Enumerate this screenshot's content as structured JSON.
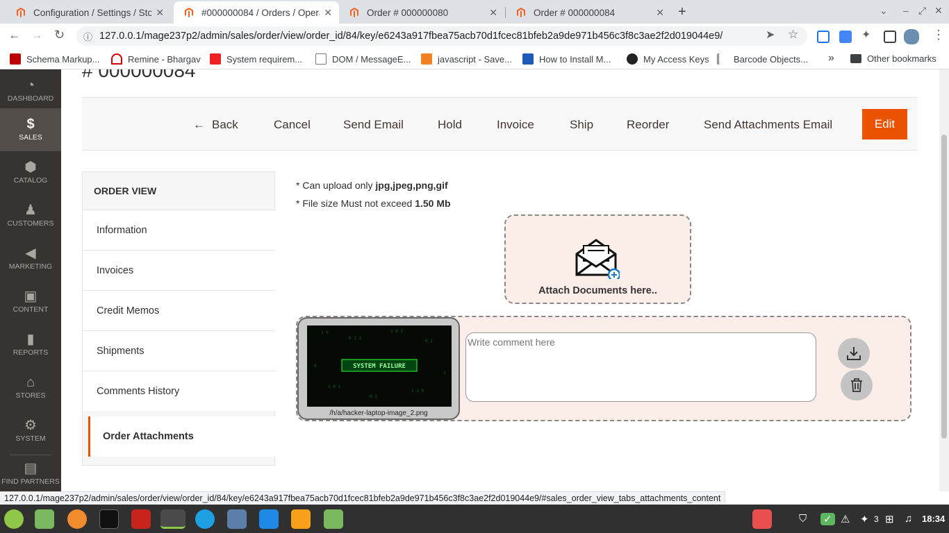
{
  "browser": {
    "tabs": [
      {
        "title": "Configuration / Settings / Sto",
        "active": false
      },
      {
        "title": "#000000084 / Orders / Opera",
        "active": true
      },
      {
        "title": "Order # 000000080",
        "active": false
      },
      {
        "title": "Order # 000000084",
        "active": false
      }
    ],
    "url": "127.0.0.1/mage237p2/admin/sales/order/view/order_id/84/key/e6243a917fbea75acb70d1fcec81bfeb2a9de971b456c3f8c3ae2f2d019044e9/",
    "bookmarks": [
      "Schema Markup...",
      "Remine - Bhargav",
      "System requirem...",
      "DOM / MessageE...",
      "javascript - Save...",
      "How to Install M...",
      "My Access Keys",
      "Barcode Objects...",
      "Other bookmarks"
    ],
    "status_url": "127.0.0.1/mage237p2/admin/sales/order/view/order_id/84/key/e6243a917fbea75acb70d1fcec81bfeb2a9de971b456c3f8c3ae2f2d019044e9/#sales_order_view_tabs_attachments_content"
  },
  "admin": {
    "accent": "#eb5202",
    "nav": [
      {
        "label": "DASHBOARD",
        "icon": "dashboard-icon"
      },
      {
        "label": "SALES",
        "icon": "dollar-icon"
      },
      {
        "label": "CATALOG",
        "icon": "box-icon"
      },
      {
        "label": "CUSTOMERS",
        "icon": "person-icon"
      },
      {
        "label": "MARKETING",
        "icon": "megaphone-icon"
      },
      {
        "label": "CONTENT",
        "icon": "layout-icon"
      },
      {
        "label": "REPORTS",
        "icon": "bar-chart-icon"
      },
      {
        "label": "STORES",
        "icon": "store-icon"
      },
      {
        "label": "SYSTEM",
        "icon": "gear-icon"
      },
      {
        "label": "FIND PARTNERS",
        "icon": "partners-icon"
      }
    ],
    "page_title": "# 000000084",
    "actions": {
      "back": "Back",
      "cancel": "Cancel",
      "send_email": "Send Email",
      "hold": "Hold",
      "invoice": "Invoice",
      "ship": "Ship",
      "reorder": "Reorder",
      "send_attachments": "Send Attachments Email",
      "edit": "Edit"
    },
    "order_view": {
      "title": "ORDER VIEW",
      "items": [
        "Information",
        "Invoices",
        "Credit Memos",
        "Shipments",
        "Comments History",
        "Order Attachments"
      ]
    },
    "attachments": {
      "note1_prefix": "* Can upload only ",
      "note1_value": "jpg,jpeg,png,gif",
      "note2_prefix": "* File size Must not exceed ",
      "note2_value": "1.50 Mb",
      "drop_label": "Attach Documents here..",
      "thumb_text": "SYSTEM FAILURE",
      "file_name": "/h/a/hacker-laptop-image_2.png",
      "comment_placeholder": "Write comment here"
    }
  },
  "taskbar": {
    "clock": "18:34",
    "notif_count": "3"
  }
}
